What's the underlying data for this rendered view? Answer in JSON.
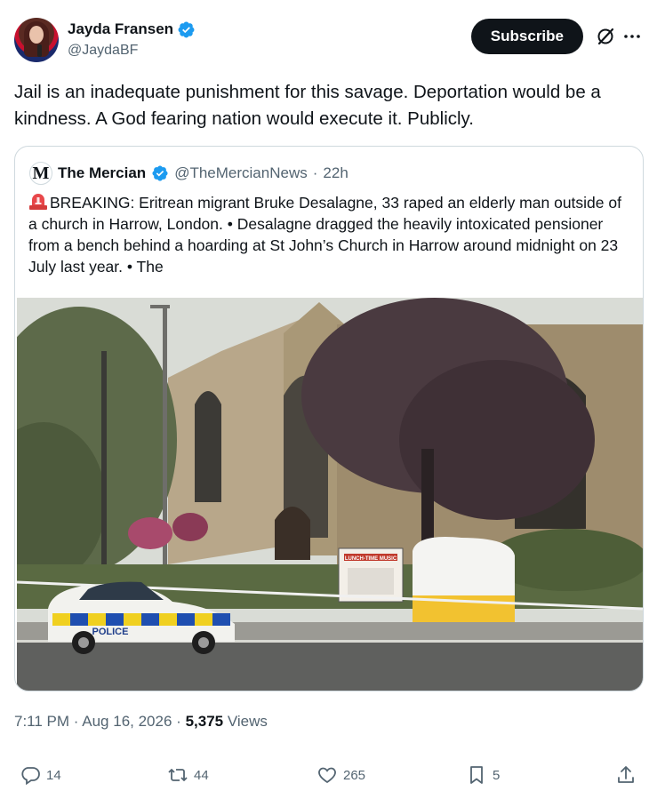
{
  "author": {
    "display_name": "Jayda Fransen",
    "handle": "@JaydaBF",
    "verified": true
  },
  "header": {
    "subscribe_label": "Subscribe",
    "icons": [
      "grok-icon",
      "more-icon"
    ]
  },
  "tweet": {
    "text": "Jail is an inadequate punishment for this savage. Deportation would be a kindness. A God fearing nation would execute it. Publicly."
  },
  "quote": {
    "avatar_letter": "M",
    "name": "The Mercian",
    "handle": "@TheMercianNews",
    "separator": "·",
    "time": "22h",
    "text": "BREAKING: Eritrean migrant Bruke Desalagne, 33 raped an elderly man outside of a church in Harrow, London. • Desalagne dragged the heavily intoxicated pensioner from a bench behind a hoarding at St John’s Church in Harrow around midnight on 23 July last year. • The",
    "photo": {
      "sign_title": "LUNCH-TIME MUSIC",
      "police_text": "POLICE"
    }
  },
  "meta": {
    "time": "7:11 PM",
    "sep1": "·",
    "date": "Aug 16, 2026",
    "sep2": "·",
    "views_count": "5,375",
    "views_label": "Views"
  },
  "actions": {
    "replies": "14",
    "retweets": "44",
    "likes": "265",
    "bookmarks": "5"
  },
  "colors": {
    "text": "#0f1419",
    "secondary": "#536471",
    "border": "#cfd9de",
    "verified": "#1d9bf0",
    "subscribe_bg": "#0f1419"
  }
}
